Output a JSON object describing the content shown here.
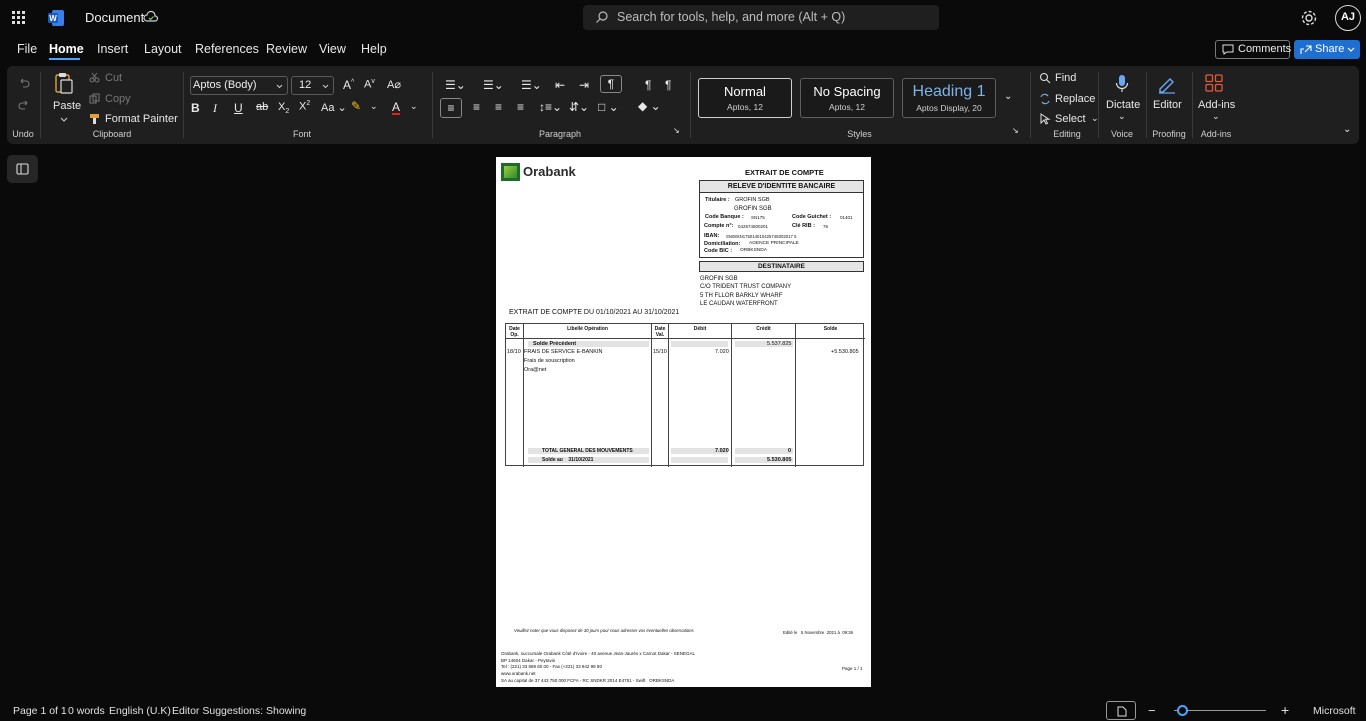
{
  "app": {
    "doc_title": "Document",
    "search_placeholder": "Search for tools, help, and more (Alt + Q)",
    "avatar_initials": "AJ"
  },
  "menu": {
    "items": [
      "File",
      "Home",
      "Insert",
      "Layout",
      "References",
      "Review",
      "View",
      "Help"
    ],
    "active": "Home",
    "comments": "Comments",
    "share": "Share"
  },
  "ribbon": {
    "undo_group": "Undo",
    "clipboard": {
      "paste": "Paste",
      "cut": "Cut",
      "copy": "Copy",
      "format_painter": "Format Painter",
      "label": "Clipboard"
    },
    "font": {
      "family": "Aptos (Body)",
      "size": "12",
      "label": "Font"
    },
    "paragraph": {
      "label": "Paragraph"
    },
    "styles": {
      "label": "Styles",
      "items": [
        {
          "name": "Normal",
          "sub": "Aptos, 12"
        },
        {
          "name": "No Spacing",
          "sub": "Aptos, 12"
        },
        {
          "name": "Heading 1",
          "sub": "Aptos Display, 20"
        }
      ]
    },
    "editing": {
      "find": "Find",
      "replace": "Replace",
      "select": "Select",
      "label": "Editing"
    },
    "voice": {
      "dictate": "Dictate",
      "label": "Voice"
    },
    "proofing": {
      "editor": "Editor",
      "label": "Proofing"
    },
    "addins": {
      "addins": "Add-ins",
      "label": "Add-ins"
    }
  },
  "document": {
    "logo": "Orabank",
    "heading": "EXTRAIT DE COMPTE",
    "rib_title": "RELEVE D'IDENTITE BANCAIRE",
    "titulaire_label": "Titulaire :",
    "titulaire": "GROFIN SGB",
    "titulaire2": "GROFIN SGB",
    "code_banque_label": "Code Banque :",
    "code_banque": "SN175",
    "code_guichet_label": "Code Guichet :",
    "code_guichet": "01401",
    "compte_label": "Compte n°:",
    "compte": "042574500201",
    "cle_label": "Clé RIB :",
    "cle": "75",
    "iban_label": "IBAN:",
    "iban": "SN08SN175014010425745002017 5",
    "domiciliation_label": "Domiciliation:",
    "domiciliation": "AGENCE PRINCIPALE",
    "bic_label": "Code BIC :",
    "bic": "ORBKSNDA",
    "destinataire_title": "DESTINATAIRE",
    "address": [
      "GROFIN SGB",
      "C/O TRIDENT TRUST COMPANY",
      "5 TH FLLOR BARKLY WHARF",
      "LE CAUDAN WATERFRONT"
    ],
    "period": "EXTRAIT DE COMPTE DU 01/10/2021  AU 31/10/2021",
    "table": {
      "headers": [
        "Date Op.",
        "Libellé Opération",
        "Date Val.",
        "Débit",
        "Crédit",
        "Solde"
      ],
      "solde_precedent_label": "Solde Précédent",
      "solde_precedent": "5.537.825",
      "row": {
        "date_op": "18/10",
        "libelle": "FRAIS DE SERVICE E-BANKIN",
        "date_val": "15/10",
        "debit": "7.020",
        "solde": "+5.530.805"
      },
      "sub_lines": [
        "Frais de souscription",
        "Ora@net"
      ],
      "total_label": "TOTAL GENERAL DES MOUVEMENTS",
      "total_debit": "7.020",
      "total_credit": "0",
      "solde_au_label": "Solde au    31/10/2021",
      "solde_au": "5.530.805"
    },
    "notice": "Veuillez noter que vous disposez de 30 jours pour nous adresser vos éventuelles observations",
    "edited": "Edité le   5 Novembre  2021 à  09:36",
    "footer": [
      "Orabank, succursale Orabank Côté d'Ivoire - 40 avenue Jean-Jaurès x Carnot Dakar - SENEGAL",
      "BP   14604 Dakar - Peytavin",
      "Tel   : (221) 33 889 60 00 - Fax (+221) 33 842 98 80",
      "www.orabank.net",
      "SA au capital de 37 443 750 000 FCFA - RC SNDKR 2014 E4751 - Swift   ORBKSNDA"
    ],
    "page_num": "Page 1 / 1"
  },
  "status": {
    "page": "Page 1 of 1",
    "words": "0 words",
    "language": "English (U.K)",
    "suggestions": "Editor Suggestions: Showing",
    "brand": "Microsoft"
  },
  "colors": {
    "accent": "#4aa3ff",
    "share": "#1f6fd1",
    "ribbon": "#1f1f1f",
    "bg": "#0a0a0a"
  }
}
